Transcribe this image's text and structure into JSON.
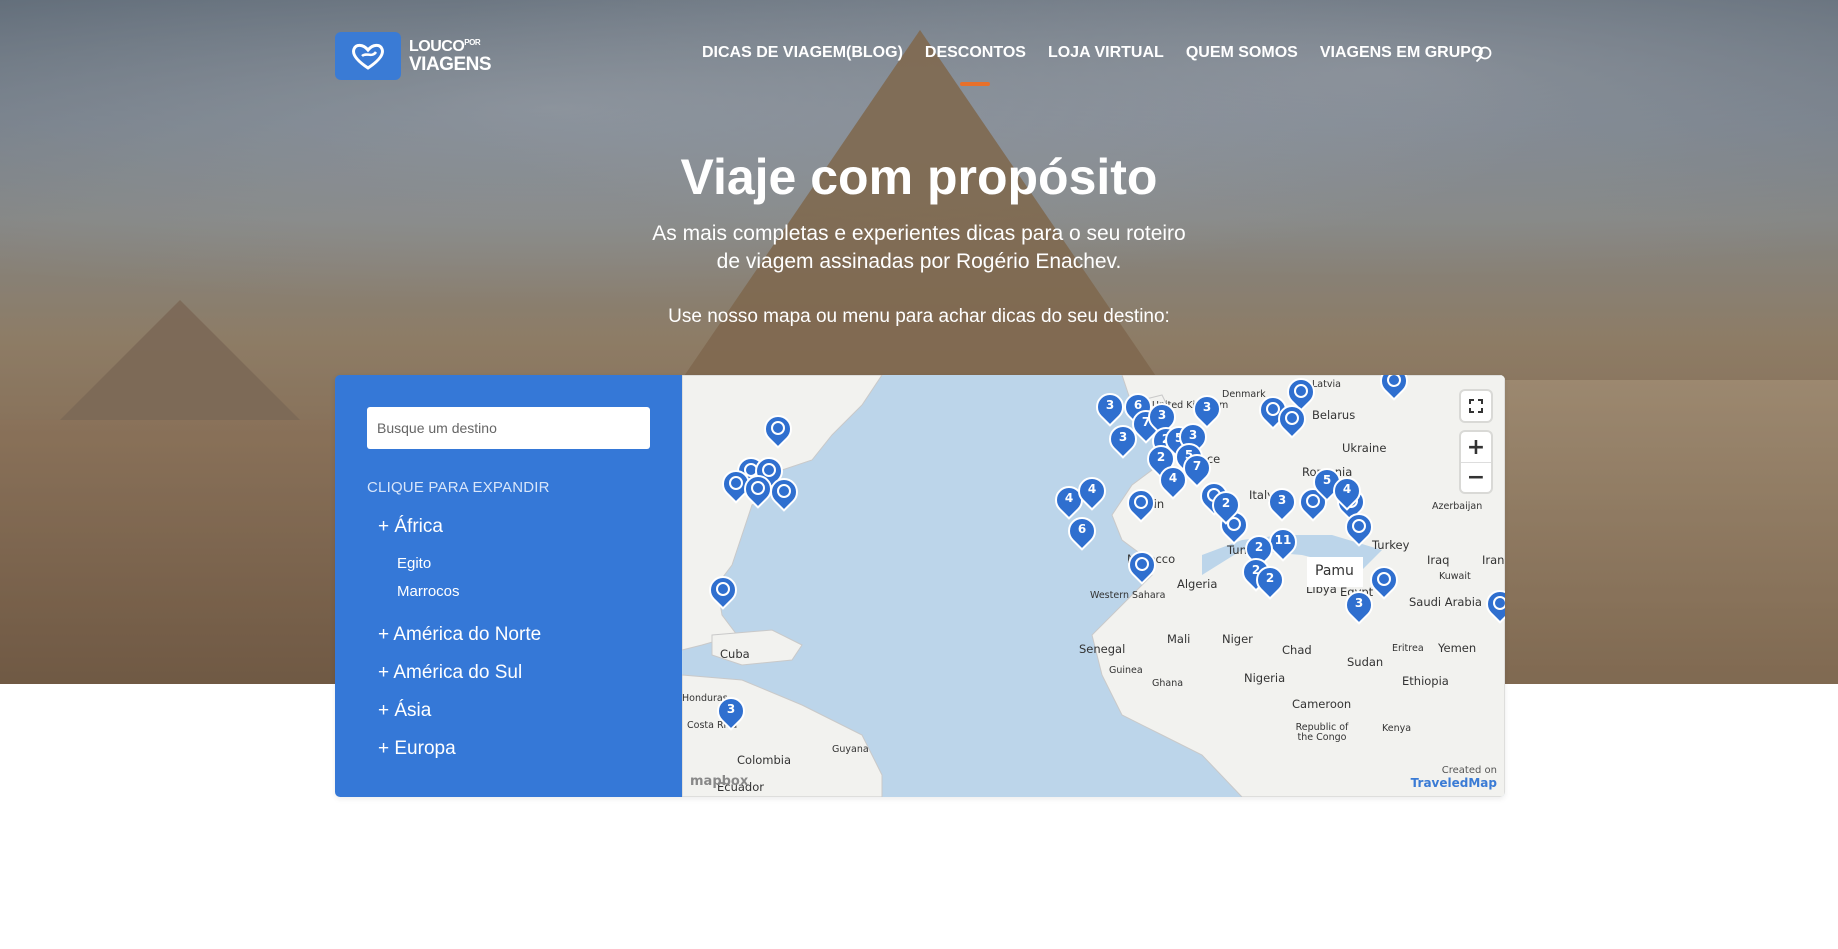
{
  "logo": {
    "line1": "LOUCO",
    "line1_small": "POR",
    "line2": "VIAGENS"
  },
  "nav": {
    "items": [
      {
        "label": "DICAS DE VIAGEM(BLOG)"
      },
      {
        "label": "DESCONTOS"
      },
      {
        "label": "LOJA VIRTUAL"
      },
      {
        "label": "QUEM SOMOS"
      },
      {
        "label": "VIAGENS EM GRUPO"
      }
    ],
    "active_index": 1,
    "search_icon": "search-icon"
  },
  "hero": {
    "title": "Viaje com propósito",
    "subtitle_line1": "As mais completas e experientes dicas para o seu roteiro",
    "subtitle_line2": "de viagem assinadas por Rogério Enachev.",
    "cta": "Use nosso mapa ou menu para achar dicas do seu destino:"
  },
  "sidebar": {
    "search_placeholder": "Busque um destino",
    "expand_label": "CLIQUE PARA EXPANDIR",
    "regions": [
      {
        "label": "+ África",
        "subs": [
          "Egito",
          "Marrocos"
        ]
      },
      {
        "label": "+ América do Norte",
        "subs": []
      },
      {
        "label": "+ América do Sul",
        "subs": []
      },
      {
        "label": "+ Ásia",
        "subs": []
      },
      {
        "label": "+ Europa",
        "subs": []
      }
    ]
  },
  "map": {
    "labels": [
      "Latvia",
      "United Kingdom",
      "Denmark",
      "Belarus",
      "Ukraine",
      "France",
      "Romania",
      "Spain",
      "Italy",
      "Turkey",
      "Azerbaijan",
      "Tunisia",
      "Morocco",
      "Algeria",
      "Libya",
      "Egypt",
      "Iraq",
      "Iran",
      "Kuwait",
      "Saudi Arabia",
      "Western Sahara",
      "Mali",
      "Niger",
      "Chad",
      "Sudan",
      "Eritrea",
      "Yemen",
      "Senegal",
      "Guinea",
      "Ghana",
      "Nigeria",
      "Cameroon",
      "Ethiopia",
      "Republic of the Congo",
      "Kenya",
      "Cuba",
      "Honduras",
      "Costa Rica",
      "Guyana",
      "Colombia",
      "Ecuador"
    ],
    "markers": [
      "3",
      "6",
      "7",
      "3",
      "2",
      "5",
      "3",
      "3",
      "3",
      "2",
      "5",
      "7",
      "4",
      "4",
      "4",
      "2",
      "3",
      "5",
      "4",
      "6",
      "11",
      "2",
      "2",
      "2",
      "3",
      "3"
    ],
    "popup_text": "Pamu",
    "fullscreen_icon": "fullscreen-icon",
    "zoom_in": "+",
    "zoom_out": "−",
    "credit_line": "Created on",
    "credit_brand": "TraveledMap",
    "mapbox": "mapbox"
  }
}
